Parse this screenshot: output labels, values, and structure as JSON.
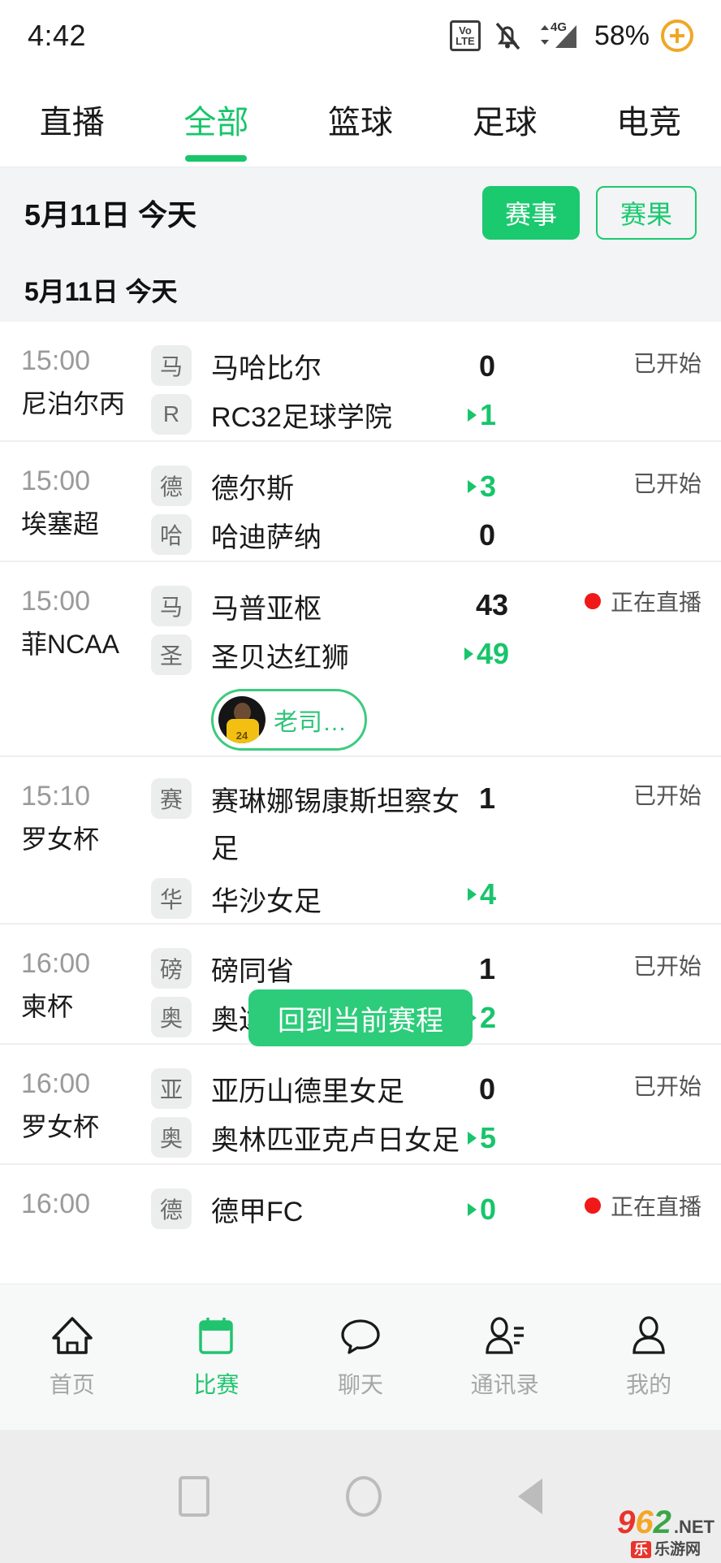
{
  "status_bar": {
    "time": "4:42",
    "volte_top": "VoLTE",
    "volte_line1": "Vo",
    "volte_line2": "LTE",
    "network": "4G",
    "battery": "58%",
    "icons": [
      "volte-icon",
      "mute-bell-icon",
      "signal-4g-icon",
      "battery-charging-icon"
    ]
  },
  "tabs": [
    {
      "label": "直播",
      "active": false
    },
    {
      "label": "全部",
      "active": true
    },
    {
      "label": "篮球",
      "active": false
    },
    {
      "label": "足球",
      "active": false
    },
    {
      "label": "电竞",
      "active": false
    }
  ],
  "date_bar": {
    "title": "5月11日  今天",
    "schedule_button": "赛事",
    "results_button": "赛果"
  },
  "sub_date": "5月11日  今天",
  "floating_button": "回到当前赛程",
  "accent_color": "#18c56b",
  "live_color": "#f01818",
  "matches": [
    {
      "time": "15:00",
      "league": "尼泊尔丙",
      "status": "已开始",
      "live": false,
      "home": {
        "badge": "马",
        "name": "马哈比尔",
        "score": "0",
        "lead": false
      },
      "away": {
        "badge": "R",
        "name": "RC32足球学院",
        "score": "1",
        "lead": true
      },
      "anchor": null
    },
    {
      "time": "15:00",
      "league": "埃塞超",
      "status": "已开始",
      "live": false,
      "home": {
        "badge": "德",
        "name": "德尔斯",
        "score": "3",
        "lead": true
      },
      "away": {
        "badge": "哈",
        "name": "哈迪萨纳",
        "score": "0",
        "lead": false
      },
      "anchor": null
    },
    {
      "time": "15:00",
      "league": "菲NCAA",
      "status": "正在直播",
      "live": true,
      "home": {
        "badge": "马",
        "name": "马普亚枢",
        "score": "43",
        "lead": false
      },
      "away": {
        "badge": "圣",
        "name": "圣贝达红狮",
        "score": "49",
        "lead": true
      },
      "anchor": {
        "name": "老司…",
        "avatar": "kobe-avatar",
        "jersey_number": "24"
      }
    },
    {
      "time": "15:10",
      "league": "罗女杯",
      "status": "已开始",
      "live": false,
      "home": {
        "badge": "赛",
        "name": "赛琳娜锡康斯坦察女足",
        "score": "1",
        "lead": false,
        "wrap": true
      },
      "away": {
        "badge": "华",
        "name": "华沙女足",
        "score": "4",
        "lead": true
      },
      "anchor": null
    },
    {
      "time": "16:00",
      "league": "柬杯",
      "status": "已开始",
      "live": false,
      "home": {
        "badge": "磅",
        "name": "磅同省",
        "score": "1",
        "lead": false
      },
      "away": {
        "badge": "奥",
        "name": "奥达尔棉奇省",
        "score": "2",
        "lead": true
      },
      "anchor": null
    },
    {
      "time": "16:00",
      "league": "罗女杯",
      "status": "已开始",
      "live": false,
      "home": {
        "badge": "亚",
        "name": "亚历山德里女足",
        "score": "0",
        "lead": false
      },
      "away": {
        "badge": "奥",
        "name": "奥林匹亚克卢日女足",
        "score": "5",
        "lead": true
      },
      "anchor": null
    },
    {
      "time": "16:00",
      "league": "",
      "status": "正在直播",
      "live": true,
      "home": {
        "badge": "德",
        "name": "德甲FC",
        "score": "0",
        "lead": true
      },
      "away": {
        "badge": "",
        "name": "",
        "score": "",
        "lead": false
      },
      "anchor": null
    }
  ],
  "bottom_nav": [
    {
      "label": "首页",
      "icon": "home-icon",
      "active": false
    },
    {
      "label": "比赛",
      "icon": "calendar-icon",
      "active": true
    },
    {
      "label": "聊天",
      "icon": "chat-bubble-icon",
      "active": false
    },
    {
      "label": "通讯录",
      "icon": "contacts-icon",
      "active": false
    },
    {
      "label": "我的",
      "icon": "person-icon",
      "active": false
    }
  ],
  "system_bar": {
    "recents": "square-icon",
    "home": "circle-icon",
    "back": "triangle-back-icon"
  },
  "watermark": {
    "d9": "9",
    "d6": "6",
    "d2": "2",
    "net": ".NET",
    "badge": "乐",
    "cn": "乐游网"
  }
}
